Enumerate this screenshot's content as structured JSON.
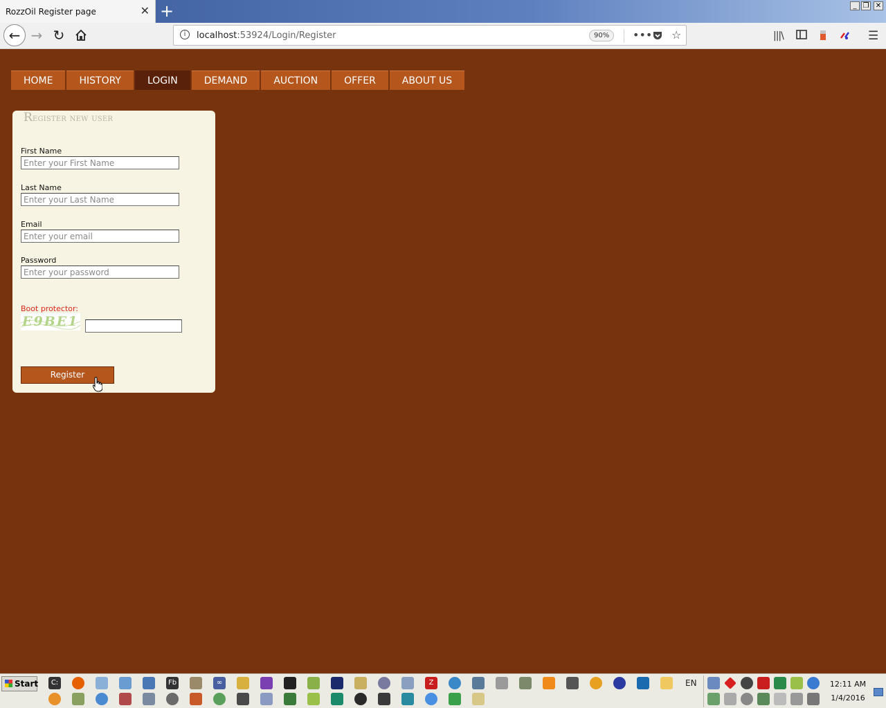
{
  "browser": {
    "tab_title": "RozzOil Register page",
    "tab_close": "✕",
    "new_tab": "+",
    "url_host": "localhost",
    "url_rest": ":53924/Login/Register",
    "zoom": "90%",
    "window_controls": [
      "_",
      "❐",
      "✕"
    ]
  },
  "menu": {
    "items": [
      "HOME",
      "HISTORY",
      "LOGIN",
      "DEMAND",
      "AUCTION",
      "OFFER",
      "ABOUT US"
    ],
    "active": "LOGIN"
  },
  "register": {
    "title_first": "R",
    "title_rest": "egister new user",
    "first_name_label": "First Name",
    "first_name_placeholder": "Enter your First Name",
    "last_name_label": "Last Name",
    "last_name_placeholder": "Enter your Last Name",
    "email_label": "Email",
    "email_placeholder": "Enter your email",
    "password_label": "Password",
    "password_placeholder": "Enter your password",
    "captcha_label": "Boot protector:",
    "captcha_image_text": "E9BE1",
    "button_label": "Register"
  },
  "taskbar": {
    "start_label": "Start",
    "language": "EN",
    "time": "12:11 AM",
    "date": "1/4/2016"
  },
  "colors": {
    "page_bg": "#76330d",
    "menu_bg": "#b5561d",
    "menu_active_bg": "#5a210a",
    "panel_bg": "#f7f4e3",
    "captcha_label": "#d8261b"
  }
}
